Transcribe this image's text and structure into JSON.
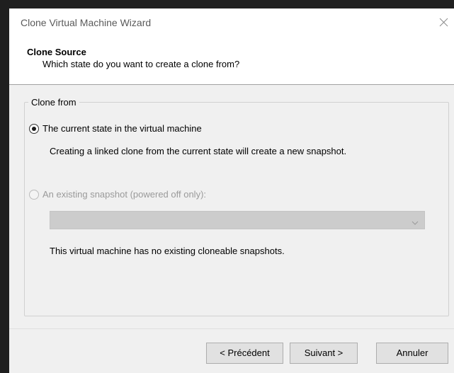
{
  "window": {
    "title": "Clone Virtual Machine Wizard"
  },
  "header": {
    "title": "Clone Source",
    "subtitle": "Which state do you want to create a clone from?"
  },
  "clone_from": {
    "legend": "Clone from",
    "option_current": {
      "label": "The current state in the virtual machine",
      "selected": true,
      "description": "Creating a linked clone from the current state will create a new snapshot."
    },
    "option_snapshot": {
      "label": "An existing snapshot (powered off only):",
      "selected": false,
      "enabled": false,
      "dropdown_value": "",
      "note": "This virtual machine has no existing cloneable snapshots."
    }
  },
  "buttons": {
    "back": "< Précédent",
    "next": "Suivant >",
    "cancel": "Annuler"
  },
  "icons": {
    "close": "close-icon",
    "dropdown": "chevron-down-icon"
  },
  "colors": {
    "dialog_background": "#f0f0f0",
    "header_background": "#ffffff",
    "disabled_text": "#9a9a9a"
  }
}
